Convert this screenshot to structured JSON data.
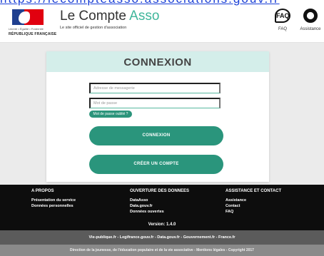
{
  "top_link": "https://lecompteasso.associations.gouv.fr",
  "header": {
    "logo": {
      "motto": "Liberté • Égalité • Fraternité",
      "republic": "RÉPUBLIQUE FRANÇAISE"
    },
    "brand_main": "Le Compte ",
    "brand_accent": "Asso",
    "brand_subtitle": "Le site officiel de gestion d'association",
    "faq_badge": "FAQ",
    "faq_label": "FAQ",
    "assistance_label": "Assistance"
  },
  "login": {
    "title": "CONNEXION",
    "email_placeholder": "Adresse de messagerie",
    "password_placeholder": "Mot de passe",
    "forgot_label": "Mot de passe oublié ?",
    "login_button": "CONNEXION",
    "create_button": "CRÉER UN COMPTE"
  },
  "footer": {
    "columns": [
      {
        "title": "A PROPOS",
        "links": [
          "Présentation du service",
          "Données personnelles"
        ]
      },
      {
        "title": "OUVERTURE DES DONNEES",
        "links": [
          "DataAsso",
          "Data.gouv.fr",
          "Données ouvertes"
        ]
      },
      {
        "title": "ASSISTANCE ET CONTACT",
        "links": [
          "Assistance",
          "Contact",
          "FAQ"
        ]
      }
    ],
    "version": "Version: 1.4.0",
    "gov_links": "Vie-publique.fr - Legifrance.gouv.fr - Data.gouv.fr - Gouvernement.fr - France.fr",
    "copyright": "Direction de la jeunesse, de l'éducation populaire et de la vie associative - Mentions légales - Copyright 2017"
  },
  "colors": {
    "accent": "#3fb69b",
    "button": "#2a957c",
    "card_header": "#d4eeea",
    "footer_bg": "#0d0d0d"
  }
}
